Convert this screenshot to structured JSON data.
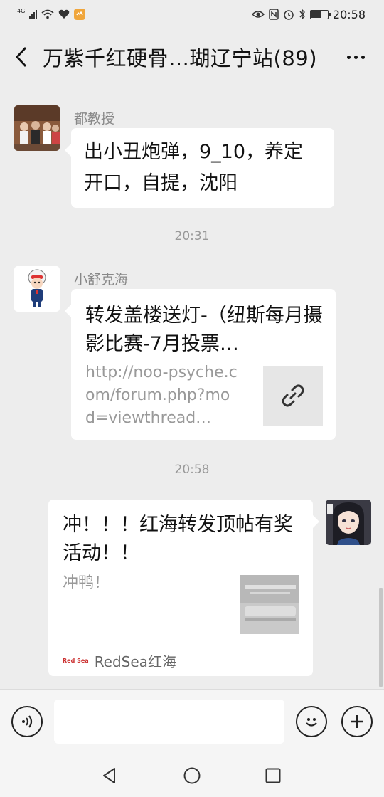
{
  "status_bar": {
    "network_label": "4G",
    "time": "20:58",
    "icons": [
      "signal-icon",
      "wifi-icon",
      "heart-icon",
      "app-notification-icon",
      "eye-icon",
      "nfc-icon",
      "alarm-icon",
      "bluetooth-icon",
      "battery-icon"
    ],
    "battery_level": 0.6
  },
  "header": {
    "title": "万紫千红硬骨…瑚辽宁站(89)",
    "back_icon": "chevron-left-icon",
    "more_icon": "more-dots-icon"
  },
  "messages": [
    {
      "sender": "都教授",
      "side": "left",
      "avatar_icon": "group-photo-avatar",
      "text": "出小丑炮弹，9_10，养定开口，自提，沈阳"
    },
    {
      "timestamp": "20:31"
    },
    {
      "sender": "小舒克海",
      "side": "left",
      "avatar_icon": "cartoon-pilot-avatar",
      "type": "link",
      "title": "转发盖楼送灯-（纽斯每月摄影比赛-7月投票…",
      "desc": "http://noo-psyche.com/forum.php?mod=viewthread…",
      "thumb_icon": "link-icon"
    },
    {
      "timestamp": "20:58"
    },
    {
      "side": "right",
      "avatar_icon": "anime-girl-avatar",
      "type": "card",
      "title": "冲！！！红海转发顶帖有奖活动！！",
      "desc": "冲鸭！",
      "source_logo": "Red Sea",
      "source": "RedSea红海"
    }
  ],
  "input_bar": {
    "voice_icon": "voice-icon",
    "emoji_icon": "emoji-icon",
    "plus_icon": "plus-icon",
    "input_value": ""
  },
  "nav_bar": {
    "icons": [
      "back-triangle-icon",
      "home-circle-icon",
      "recents-square-icon"
    ]
  },
  "colors": {
    "background": "#ededed",
    "bubble": "#ffffff",
    "battery_badge": "#f0a63c"
  }
}
